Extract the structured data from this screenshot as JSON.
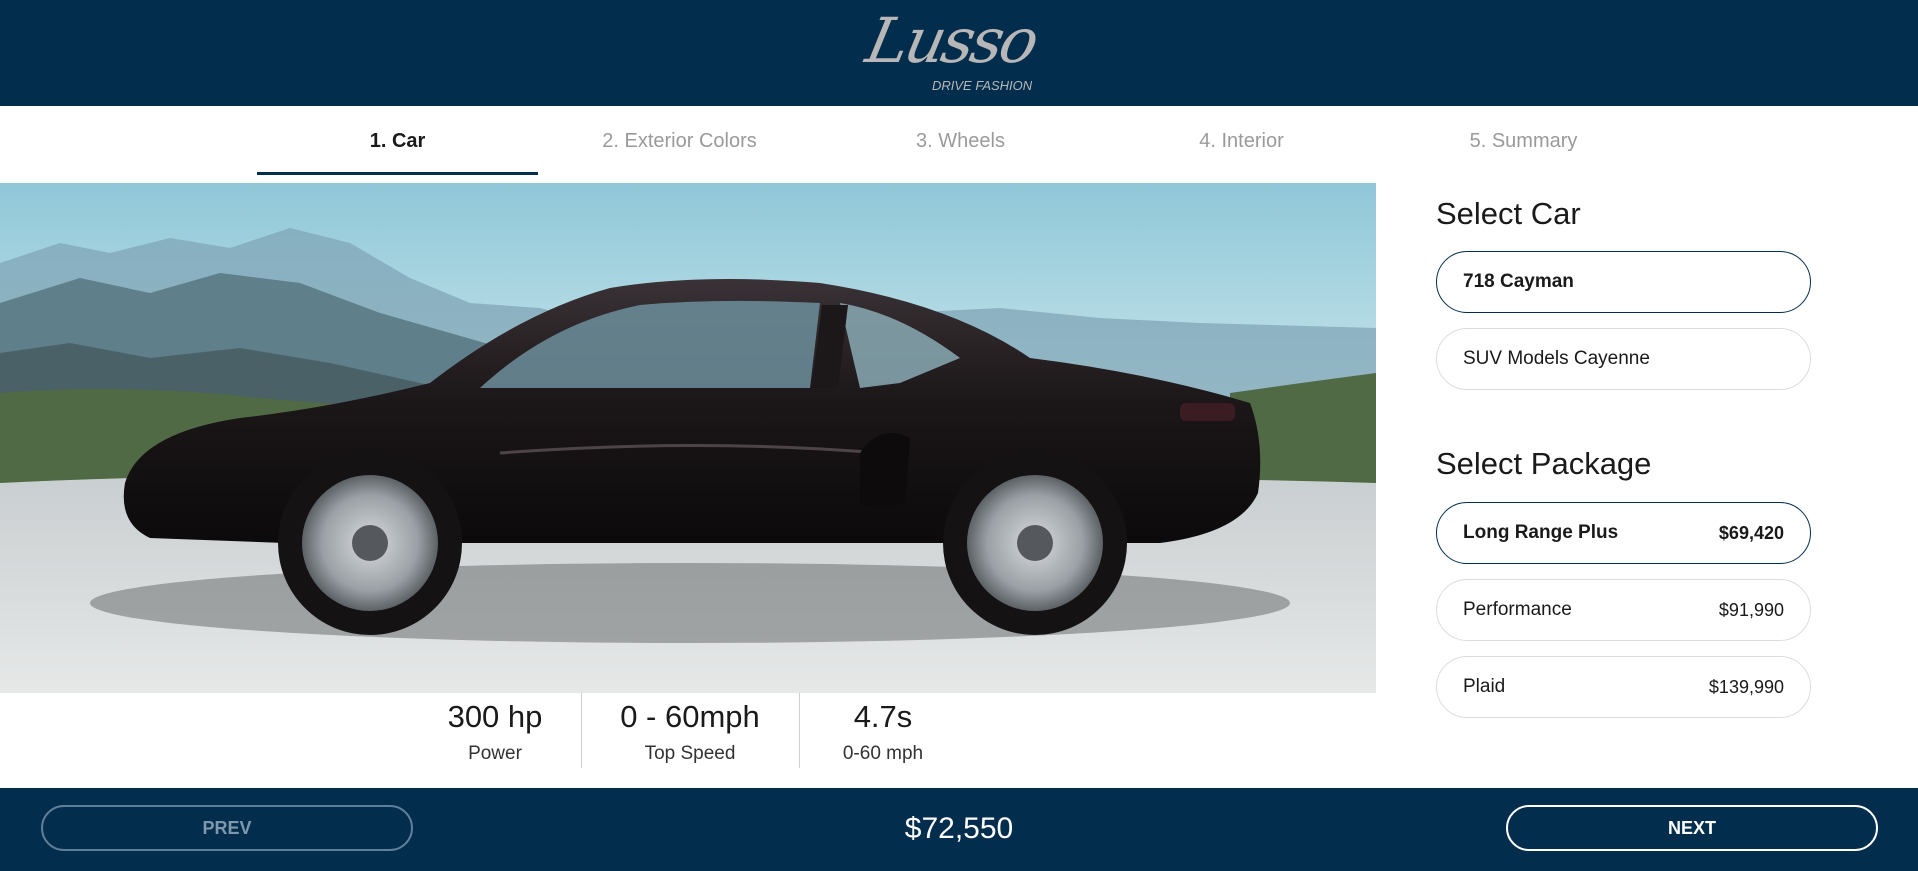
{
  "brand": {
    "name": "Lusso",
    "tagline": "DRIVE FASHION"
  },
  "tabs": [
    {
      "label": "1. Car",
      "active": true
    },
    {
      "label": "2. Exterior Colors",
      "active": false
    },
    {
      "label": "3. Wheels",
      "active": false
    },
    {
      "label": "4. Interior",
      "active": false
    },
    {
      "label": "5. Summary",
      "active": false
    }
  ],
  "specs": [
    {
      "value": "300 hp",
      "label": "Power"
    },
    {
      "value": "0 - 60mph",
      "label": "Top Speed"
    },
    {
      "value": "4.7s",
      "label": "0-60 mph"
    }
  ],
  "select_car": {
    "title": "Select Car",
    "options": [
      {
        "label": "718 Cayman",
        "selected": true
      },
      {
        "label": "SUV Models Cayenne",
        "selected": false
      }
    ]
  },
  "select_package": {
    "title": "Select Package",
    "options": [
      {
        "label": "Long Range Plus",
        "price": "$69,420",
        "selected": true
      },
      {
        "label": "Performance",
        "price": "$91,990",
        "selected": false
      },
      {
        "label": "Plaid",
        "price": "$139,990",
        "selected": false
      }
    ]
  },
  "footer": {
    "prev_label": "PREV",
    "total": "$72,550",
    "next_label": "NEXT"
  },
  "colors": {
    "brand_navy": "#032d4d",
    "car_body": "#1c1719"
  }
}
